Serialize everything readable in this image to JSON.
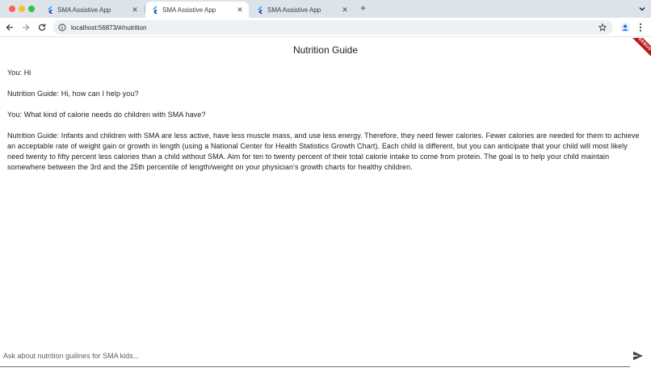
{
  "browser": {
    "tabs": [
      {
        "title": "SMA Assistive App",
        "active": false
      },
      {
        "title": "SMA Assistive App",
        "active": true
      },
      {
        "title": "SMA Assistive App",
        "active": false
      }
    ],
    "url": "localhost:56873/#/nutrition"
  },
  "app": {
    "title": "Nutrition Guide",
    "debug_banner": "DEBUG",
    "messages": [
      "You: Hi",
      "Nutrition Guide: Hi, how can I help you?",
      "You: What kind of calorie needs do children with SMA have?",
      "Nutrition Guide: Infants and children with SMA are less active, have less muscle mass, and use less energy. Therefore, they need fewer calories. Fewer calories are needed for them to achieve an acceptable rate of weight gain or growth in length (using a National Center for Health Statistics Growth Chart). Each child is different, but you can anticipate that your child will most likely need twenty to fifty percent less calories than a child without SMA. Aim for ten to twenty percent of their total calorie intake to come from protein. The goal is to help your child maintain somewhere between the 3rd and the 25th percentile of length/weight on your physician's growth charts for healthy children."
    ],
    "input": {
      "placeholder": "Ask about nutrition guilines for SMA kids...",
      "value": ""
    }
  },
  "icons": {
    "favicon": "flutter-logo-icon",
    "send": "send-icon"
  }
}
